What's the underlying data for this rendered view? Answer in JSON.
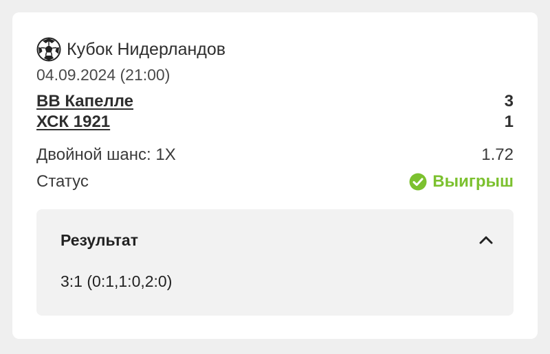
{
  "match": {
    "tournament": "Кубок Нидерландов",
    "sport_icon": "soccer-ball-icon",
    "datetime": "04.09.2024 (21:00)",
    "home_team": "ВВ Капелле",
    "home_score": "3",
    "away_team": "ХСК 1921",
    "away_score": "1"
  },
  "bet": {
    "label": "Двойной шанс: 1X",
    "odds": "1.72"
  },
  "status": {
    "label": "Статус",
    "value": "Выигрыш",
    "icon": "check-circle-icon",
    "color": "#7cc12f"
  },
  "result": {
    "title": "Результат",
    "toggle_icon": "chevron-up-icon",
    "score_detail": "3:1 (0:1,1:0,2:0)"
  }
}
